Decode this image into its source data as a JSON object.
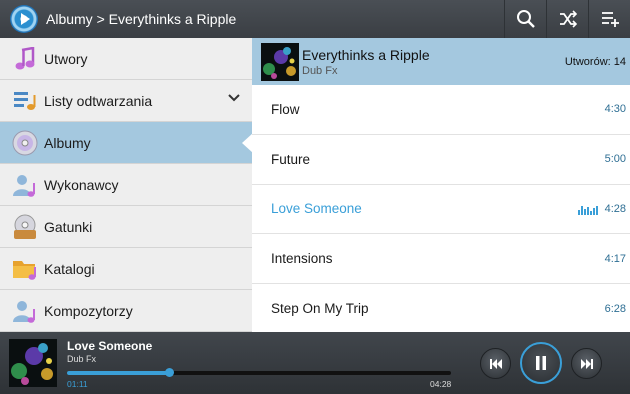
{
  "header": {
    "breadcrumb": "Albumy > Everythinks a Ripple",
    "icons": [
      "search-icon",
      "shuffle-icon",
      "add-to-playlist-icon"
    ]
  },
  "sidebar": {
    "items": [
      {
        "label": "Utwory",
        "icon": "music-note-icon"
      },
      {
        "label": "Listy odtwarzania",
        "icon": "playlist-icon"
      },
      {
        "label": "Albumy",
        "icon": "album-disc-icon"
      },
      {
        "label": "Wykonawcy",
        "icon": "artist-icon"
      },
      {
        "label": "Gatunki",
        "icon": "genre-icon"
      },
      {
        "label": "Katalogi",
        "icon": "folder-icon"
      },
      {
        "label": "Kompozytorzy",
        "icon": "composer-icon"
      }
    ],
    "active_index": 2
  },
  "album": {
    "title": "Everythinks a Ripple",
    "artist": "Dub Fx",
    "track_count": "Utworów: 14"
  },
  "tracks": [
    {
      "title": "Flow",
      "duration": "4:30"
    },
    {
      "title": "Future",
      "duration": "5:00"
    },
    {
      "title": "Love Someone",
      "duration": "4:28",
      "playing": true
    },
    {
      "title": "Intensions",
      "duration": "4:17"
    },
    {
      "title": "Step On My Trip",
      "duration": "6:28"
    }
  ],
  "now_playing": {
    "title": "Love Someone",
    "artist": "Dub Fx",
    "current_time": "01:11",
    "total_time": "04:28",
    "progress": 0.265
  },
  "colors": {
    "accent": "#3a9fd8",
    "active_bg": "#a4c8df",
    "topbar": "#3a3e43"
  }
}
